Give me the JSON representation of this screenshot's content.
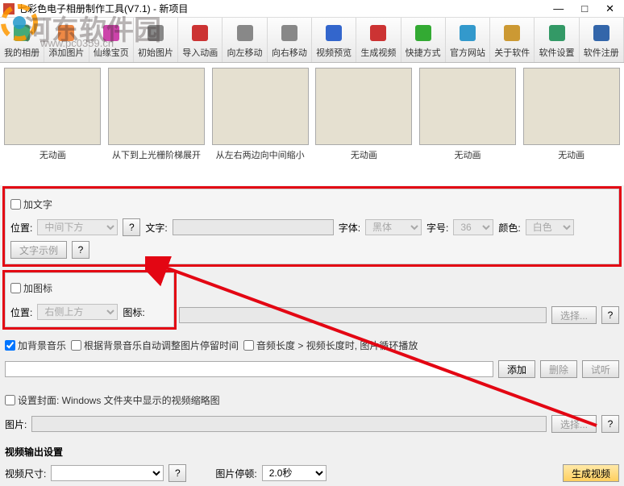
{
  "title": "七彩色电子相册制作工具(V7.1) - 新项目",
  "win": {
    "min": "—",
    "max": "□",
    "close": "✕"
  },
  "toolbar": [
    {
      "label": "我的相册",
      "icon": "album-icon"
    },
    {
      "label": "添加图片",
      "icon": "add-image-icon"
    },
    {
      "label": "仙缘宝页",
      "icon": "page-icon"
    },
    {
      "label": "初始图片",
      "icon": "init-icon"
    },
    {
      "label": "导入动画",
      "icon": "import-icon"
    },
    {
      "label": "向左移动",
      "icon": "arrow-left-icon"
    },
    {
      "label": "向右移动",
      "icon": "arrow-right-icon"
    },
    {
      "label": "视频预览",
      "icon": "preview-icon"
    },
    {
      "label": "生成视频",
      "icon": "generate-icon"
    },
    {
      "label": "快捷方式",
      "icon": "shortcut-icon"
    },
    {
      "label": "官方网站",
      "icon": "website-icon"
    },
    {
      "label": "关于软件",
      "icon": "about-icon"
    },
    {
      "label": "软件设置",
      "icon": "settings-icon"
    },
    {
      "label": "软件注册",
      "icon": "register-icon"
    }
  ],
  "thumbs": [
    {
      "cap": "无动画"
    },
    {
      "cap": "从下到上光栅阶梯展开"
    },
    {
      "cap": "从左右两边向中间缩小"
    },
    {
      "cap": "无动画"
    },
    {
      "cap": "无动画"
    },
    {
      "cap": "无动画"
    }
  ],
  "text_section": {
    "checkbox": "加文字",
    "pos_label": "位置:",
    "pos_value": "中间下方",
    "text_label": "文字:",
    "font_label": "字体:",
    "font_value": "黑体",
    "size_label": "字号:",
    "size_value": "36",
    "color_label": "颜色:",
    "color_value": "白色",
    "example_btn": "文字示例"
  },
  "icon_section": {
    "checkbox": "加图标",
    "pos_label": "位置:",
    "pos_value": "右侧上方",
    "icon_label": "图标:",
    "select_btn": "选择...",
    "q": "?"
  },
  "music_section": {
    "bgm": "加背景音乐",
    "autofit": "根据背景音乐自动调整图片停留时间",
    "loop_prefix": "音频长度 > 视频长度时, 图片循环播放",
    "add": "添加",
    "del": "删除",
    "test": "试听"
  },
  "cover_section": {
    "checkbox": "设置封面: Windows 文件夹中显示的视频缩略图",
    "img_label": "图片:",
    "select_btn": "选择...",
    "q": "?"
  },
  "output_section": {
    "title": "视频输出设置",
    "size_label": "视频尺寸:",
    "dur_label": "图片停顿:",
    "dur_value": "2.0秒",
    "gen_btn": "生成视频"
  },
  "watermark": {
    "name": "河东软件园",
    "url": "www.pc0359.cn"
  }
}
